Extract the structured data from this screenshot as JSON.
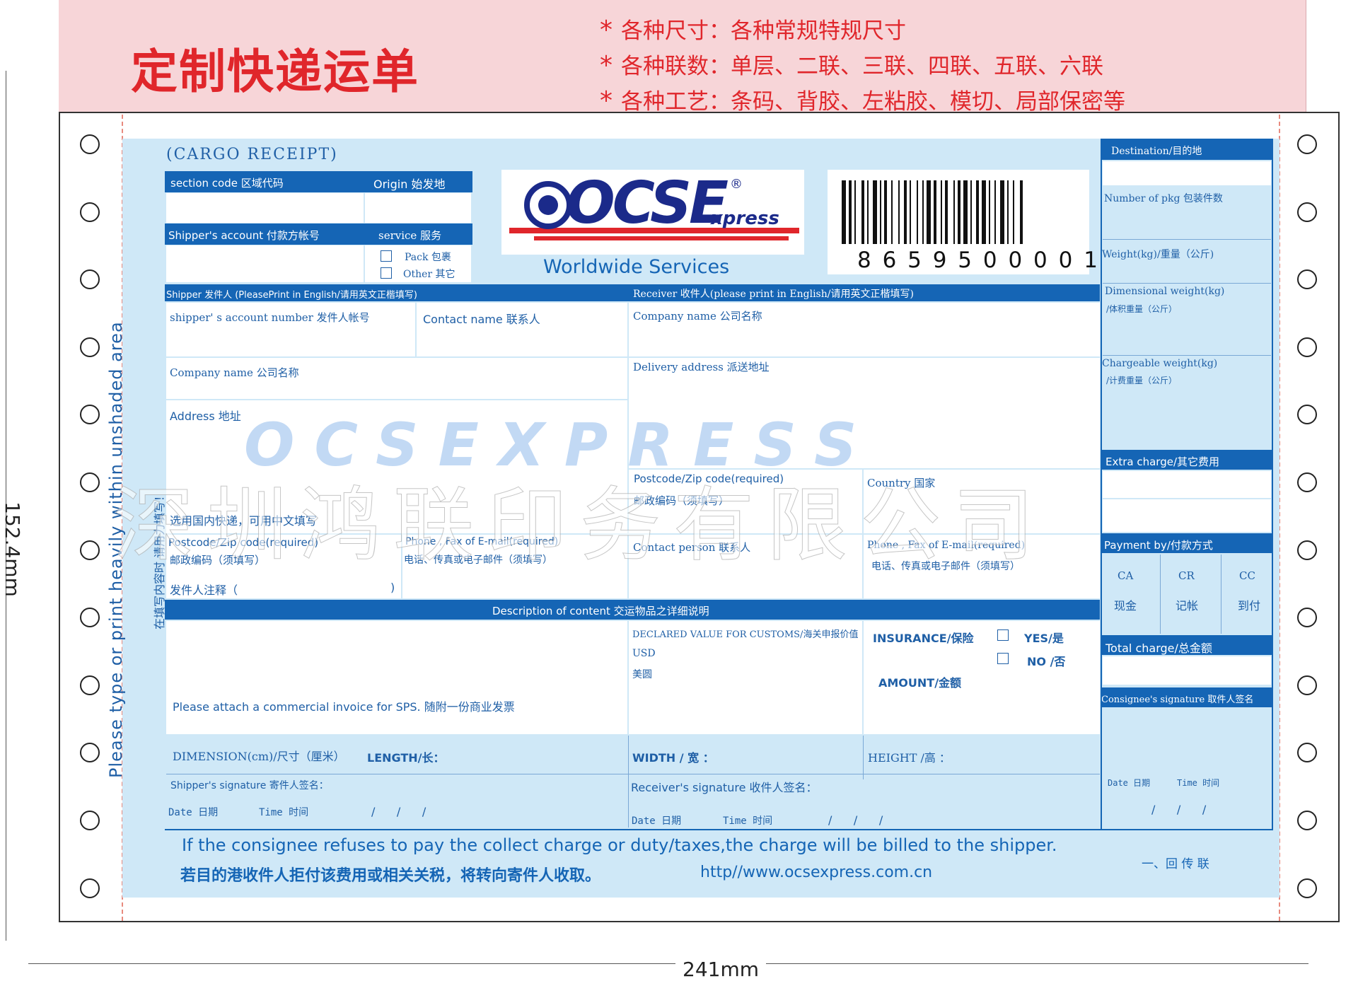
{
  "banner": {
    "title": "定制快递运单",
    "specs": [
      "各种尺寸：各种常规特规尺寸",
      "各种联数：单层、二联、三联、四联、五联、六联",
      "各种工艺：条码、背胶、左粘胶、模切、局部保密等"
    ],
    "star": "*"
  },
  "dimensions": {
    "height": "152.4mm",
    "width": "241mm"
  },
  "side": {
    "vertical_en": "Please type or print heavily within unshaded area",
    "vertical_cn": "在填写内容时 请用力填写！"
  },
  "watermark": {
    "en": "OCSEXPRESS",
    "cn": "深圳鸿联印务有限公司"
  },
  "form": {
    "cargo_receipt": "(CARGO RECEIPT)",
    "section_code": "section code 区域代码",
    "origin": "Origin 始发地",
    "shipper_account": "Shipper's account 付款方帐号",
    "service": "service 服务",
    "pack": "Pack 包裹",
    "other": "Other 其它",
    "logo_text": "OCSE",
    "logo_xpress": "xpress",
    "logo_reg": "®",
    "worldwide": "Worldwide Services",
    "barcode_number": "8 6 5 9 5 0 0 0 0 1",
    "shipper_bar": "Shipper 发件人 (PleasePrint in English/请用英文正楷填写)",
    "receiver_bar": "Receiver 收件人(please print in English/请用英文正楷填写)",
    "shipper_account_number": "shipper' s account number 发件人帐号",
    "contact_name": "Contact name 联系人",
    "company_name": "Company name 公司名称",
    "receiver_company": "Company name 公司名称",
    "address": "Address 地址",
    "delivery_address": "Delivery address 派送地址",
    "domestic_note": "选用国内快递，可用中文填写",
    "postcode_en": "Postcode/Zip code(required)",
    "postcode_cn": "邮政编码（须填写）",
    "phone_en": "Phone , Fax of E-mail(required)",
    "phone_cn": "电话、传真或电子邮件（须填写）",
    "shipper_note": "发件人注释（",
    "shipper_note_close": ")",
    "r_postcode_en": "Postcode/Zip code(required)",
    "r_postcode_cn": "邮政编码（须填写）",
    "country": "Country 国家",
    "contact_person": "Contact person 联系人",
    "r_phone_en": "Phone , Fax of E-mail(required)",
    "r_phone_cn": "电话、传真或电子邮件（须填写）",
    "desc_bar": "Description of content 交运物品之详细说明",
    "declared_value": "DECLARED VALUE FOR CUSTOMS/海关申报价值",
    "usd": "USD",
    "yuan": "美圆",
    "insurance": "INSURANCE/保险",
    "yes": "YES/是",
    "no": "NO /否",
    "amount": "AMOUNT/金额",
    "invoice_note": "Please attach a commercial invoice for SPS. 随附一份商业发票",
    "dimension": "DIMENSION(cm)/尺寸（厘米）",
    "length": "LENGTH/长：",
    "width": "WIDTH /  宽 ：",
    "height": "HEIGHT /高 ：",
    "shipper_signature": "Shipper's signature 寄件人签名：",
    "receiver_signature": "Receiver's signature 收件人签名：",
    "date": "Date 日期",
    "time": "Time 时间",
    "slashes": "/      /      /",
    "footer_en": "If the consignee refuses to pay the collect charge or duty/taxes,the charge will be billed  to the  shipper.",
    "footer_cn": "若目的港收件人拒付该费用或相关关税，将转向寄件人收取。",
    "url": "http//www.ocsexpress.com.cn",
    "copy_label": "一、回 传 联"
  },
  "right": {
    "destination": "Destination/目的地",
    "number_pkg": "Number of pkg 包装件数",
    "weight": "Weight(kg)/重量（公斤)",
    "dim_weight_en": "Dimensional weight(kg)",
    "dim_weight_cn": "/体积重量（公斤）",
    "charge_weight_en": "Chargeable weight(kg)",
    "charge_weight_cn": "/计费重量（公斤）",
    "extra_charge": "Extra charge/其它费用",
    "payment": "Payment  by/付款方式",
    "ca": "CA",
    "cr": "CR",
    "cc": "CC",
    "ca_cn": "现金",
    "cr_cn": "记帐",
    "cc_cn": "到付",
    "total_charge": "Total charge/总金额",
    "consignee_sig": "Consignee's signature 取件人签名",
    "date": "Date 日期",
    "time": "Time 时间",
    "slashes": "/      /      /"
  },
  "colors": {
    "accent": "#1565b5",
    "form_bg": "#cfe8f7",
    "banner_red": "#e0262b",
    "banner_bg": "#f7d5d8"
  }
}
